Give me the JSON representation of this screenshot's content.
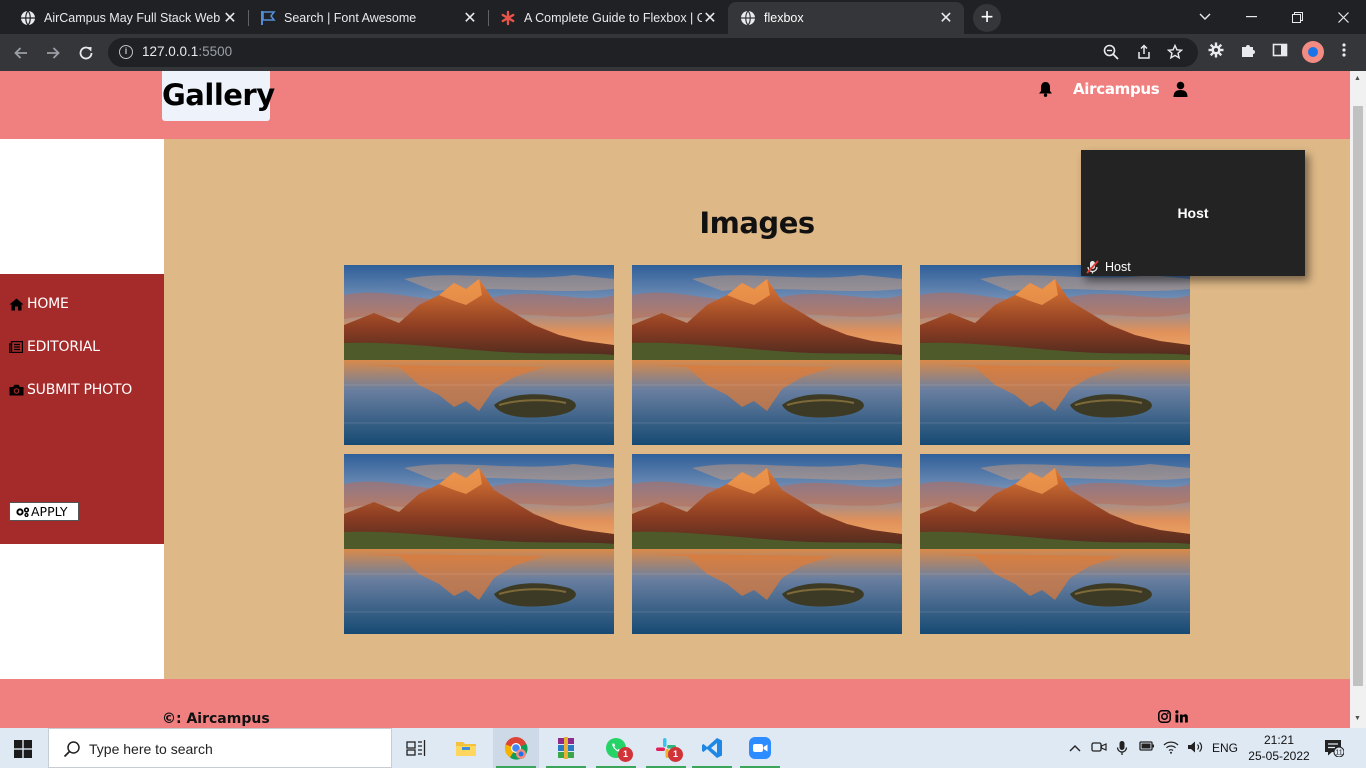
{
  "browser": {
    "tabs": [
      {
        "title": "AirCampus May Full Stack Web D",
        "icon": "globe-icon",
        "active": false
      },
      {
        "title": "Search | Font Awesome",
        "icon": "flag-icon",
        "active": false
      },
      {
        "title": "A Complete Guide to Flexbox | C",
        "icon": "asterisk-icon",
        "active": false
      },
      {
        "title": "flexbox",
        "icon": "globe-icon",
        "active": true
      }
    ],
    "close_glyph": "✕",
    "new_tab_glyph": "+",
    "address": {
      "host": "127.0.0.1",
      "port": ":5500"
    }
  },
  "page": {
    "logo": "Gallery",
    "brand": "Aircampus",
    "heading": "Images",
    "sidebar": {
      "items": [
        {
          "label": "HOME",
          "icon": "home-icon"
        },
        {
          "label": "EDITORIAL",
          "icon": "newspaper-icon"
        },
        {
          "label": "SUBMIT PHOTO",
          "icon": "camera-icon"
        }
      ],
      "apply_label": "APPLY",
      "apply_icon": "gears-icon"
    },
    "gallery": {
      "image_count": 6,
      "image_subject": "mountain-lake-sunset"
    },
    "host_panel": {
      "title": "Host",
      "label": "Host"
    },
    "footer": {
      "copyright": "©: Aircampus",
      "social": [
        "instagram-icon",
        "linkedin-icon"
      ]
    }
  },
  "taskbar": {
    "search_placeholder": "Type here to search",
    "apps": [
      {
        "name": "task-view",
        "badge": ""
      },
      {
        "name": "file-explorer",
        "badge": ""
      },
      {
        "name": "chrome",
        "badge": ""
      },
      {
        "name": "winrar",
        "badge": ""
      },
      {
        "name": "whatsapp",
        "badge": "1"
      },
      {
        "name": "slack",
        "badge": "1"
      },
      {
        "name": "vscode",
        "badge": ""
      },
      {
        "name": "zoom",
        "badge": ""
      }
    ],
    "language": "ENG",
    "time": "21:21",
    "date": "25-05-2022",
    "notification_count": "11"
  },
  "colors": {
    "header_bg": "#f08080",
    "sidebar_bg": "#a52a2a",
    "main_bg": "#deb887",
    "host_panel_bg": "#232323"
  }
}
